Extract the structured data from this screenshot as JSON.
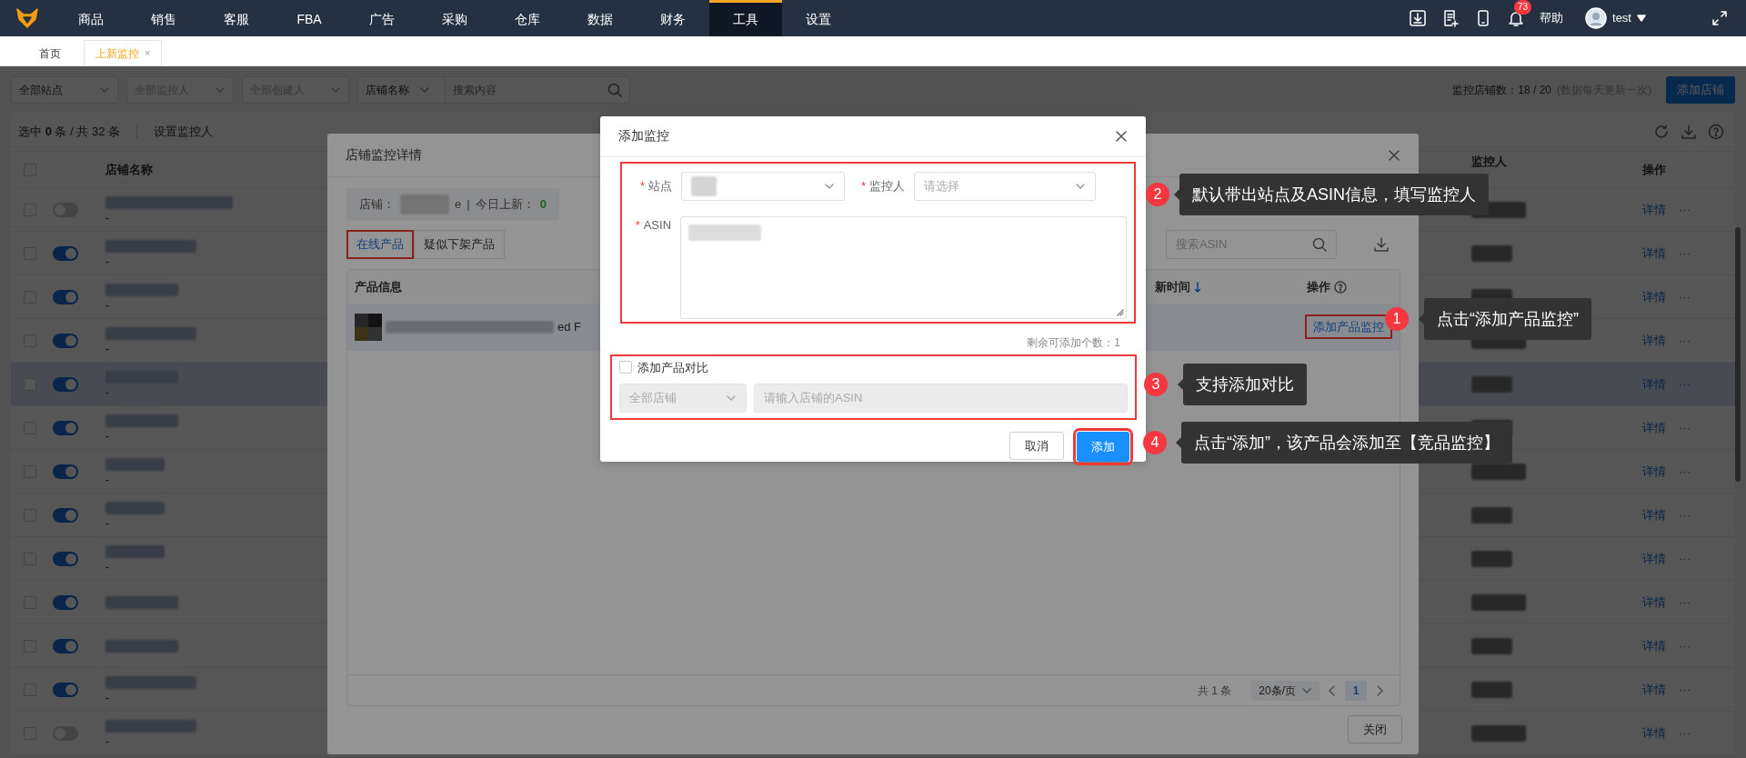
{
  "top_nav": {
    "menu": [
      {
        "label": "商品",
        "selected": false
      },
      {
        "label": "销售",
        "selected": false
      },
      {
        "label": "客服",
        "selected": false
      },
      {
        "label": "FBA",
        "selected": false
      },
      {
        "label": "广告",
        "selected": false
      },
      {
        "label": "采购",
        "selected": false
      },
      {
        "label": "仓库",
        "selected": false
      },
      {
        "label": "数据",
        "selected": false
      },
      {
        "label": "财务",
        "selected": false
      },
      {
        "label": "工具",
        "selected": true
      },
      {
        "label": "设置",
        "selected": false
      }
    ],
    "notification_count": "73",
    "help": "帮助",
    "user": "test"
  },
  "page_tabs": [
    {
      "label": "首页",
      "selected": false
    },
    {
      "label": "上新监控",
      "selected": true,
      "close": "×"
    }
  ],
  "filters": {
    "selects": [
      {
        "value": "全部站点"
      },
      {
        "placeholder": "全部监控人"
      },
      {
        "placeholder": "全部创建人"
      }
    ],
    "search_type": "店铺名称",
    "search": {
      "placeholder": "搜索内容"
    }
  },
  "monitor_summary": "监控店铺数：18 / 20",
  "update_note": "(数据每天更新一次)",
  "add_store_button": "添加店铺",
  "selection_summary": "选中 **0** 条 / 共 32 条",
  "set_monitor_button": "设置监控人",
  "store_table": {
    "select_all_checked": false,
    "columns": [
      "店铺名称",
      "监控人",
      "操作"
    ],
    "rows": [
      {
        "checked": false,
        "enabled": false,
        "highlighted": false,
        "subtitle": "-",
        "action": "详情",
        "more": "···"
      },
      {
        "checked": false,
        "enabled": true,
        "highlighted": false,
        "subtitle": "-",
        "action": "详情",
        "more": "···"
      },
      {
        "checked": false,
        "enabled": true,
        "highlighted": false,
        "subtitle": "-",
        "action": "详情",
        "more": "···"
      },
      {
        "checked": false,
        "enabled": true,
        "highlighted": false,
        "subtitle": "-",
        "action": "详情",
        "more": "···"
      },
      {
        "checked": false,
        "enabled": true,
        "highlighted": true,
        "subtitle": "-",
        "action": "详情",
        "more": "···"
      },
      {
        "checked": false,
        "enabled": true,
        "highlighted": false,
        "subtitle": "-",
        "action": "详情",
        "more": "···"
      },
      {
        "checked": false,
        "enabled": true,
        "highlighted": false,
        "subtitle": "-",
        "action": "详情",
        "more": "···"
      },
      {
        "checked": false,
        "enabled": true,
        "highlighted": false,
        "subtitle": "-",
        "action": "详情",
        "more": "···"
      },
      {
        "checked": false,
        "enabled": true,
        "highlighted": false,
        "subtitle": "-",
        "action": "详情",
        "more": "···"
      },
      {
        "checked": false,
        "enabled": true,
        "highlighted": false,
        "action": "详情",
        "more": "···"
      },
      {
        "checked": false,
        "enabled": true,
        "highlighted": false,
        "action": "详情",
        "more": "···"
      },
      {
        "checked": false,
        "enabled": true,
        "highlighted": false,
        "subtitle": "-",
        "action": "详情",
        "more": "···"
      },
      {
        "checked": false,
        "enabled": false,
        "highlighted": false,
        "subtitle": "-",
        "action": "详情",
        "more": "···"
      }
    ]
  },
  "detail_dialog": {
    "title": "店铺监控详情",
    "store_label": "店铺：",
    "store_suffix": "e",
    "separator": "|",
    "today_label": "今日上新：",
    "today_count": "0",
    "tabs": [
      {
        "label": "在线产品",
        "selected": true,
        "highlighted": true
      },
      {
        "label": "疑似下架产品",
        "selected": false,
        "highlighted": false
      }
    ],
    "search": {
      "placeholder": "搜索ASIN"
    },
    "columns": [
      "产品信息",
      "新时间",
      "操作"
    ],
    "rows": [
      {
        "title_fragment": "ed F",
        "action": "添加产品监控",
        "action_highlighted": true
      }
    ],
    "pagination": {
      "total_prefix": "共",
      "total": "1",
      "total_suffix": "条",
      "page_size": "20条/页",
      "pages": [
        {
          "label": "1",
          "selected": true
        }
      ]
    },
    "close_button": "关闭"
  },
  "add_dialog": {
    "title": "添加监控",
    "main_highlighted": true,
    "required_mark": "*",
    "fields": [
      {
        "label": "站点",
        "required": true,
        "kind": "select"
      },
      {
        "label": "监控人",
        "required": true,
        "kind": "select",
        "placeholder": "请选择"
      },
      {
        "label": "ASIN",
        "required": true,
        "kind": "textarea"
      }
    ],
    "remaining": "剩余可添加个数：1",
    "compare": {
      "label": "添加产品对比",
      "checked": false,
      "highlighted": true,
      "disabled": true,
      "store_value": "全部店铺",
      "asin_placeholder": "请输入店铺的ASIN"
    },
    "buttons": [
      {
        "label": "取消",
        "kind": "secondary",
        "highlighted": false
      },
      {
        "label": "添加",
        "kind": "primary",
        "highlighted": true
      }
    ]
  },
  "annotations": [
    {
      "number": "2",
      "text": "默认带出站点及ASIN信息，填写监控人"
    },
    {
      "number": "1",
      "text": "点击“添加产品监控”"
    },
    {
      "number": "3",
      "text": "支持添加对比"
    },
    {
      "number": "4",
      "text": "点击“添加”，该产品会添加至【竞品监控】"
    }
  ]
}
